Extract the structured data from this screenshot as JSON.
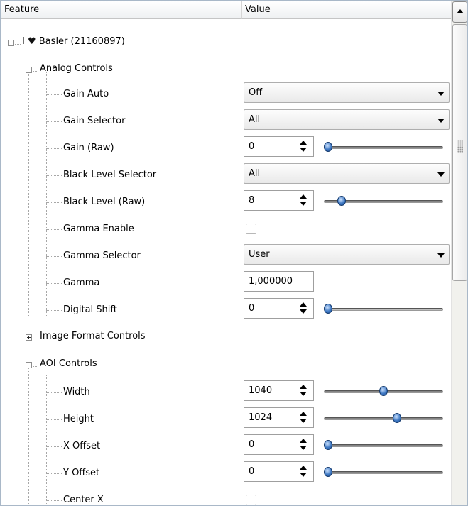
{
  "header": {
    "feature_label": "Feature",
    "value_label": "Value"
  },
  "root": {
    "prefix": "I",
    "heart": "♥",
    "name": "Basler (21160897)"
  },
  "groups": {
    "analog": "Analog Controls",
    "image_format": "Image Format Controls",
    "aoi": "AOI Controls"
  },
  "analog": {
    "gain_auto": {
      "label": "Gain Auto",
      "value": "Off"
    },
    "gain_selector": {
      "label": "Gain Selector",
      "value": "All"
    },
    "gain_raw": {
      "label": "Gain (Raw)",
      "value": "0",
      "level": 0.0
    },
    "black_level_selector": {
      "label": "Black Level Selector",
      "value": "All"
    },
    "black_level_raw": {
      "label": "Black Level (Raw)",
      "value": "8",
      "level": 0.12
    },
    "gamma_enable": {
      "label": "Gamma Enable",
      "checked": false
    },
    "gamma_selector": {
      "label": "Gamma Selector",
      "value": "User"
    },
    "gamma": {
      "label": "Gamma",
      "value": "1,000000"
    },
    "digital_shift": {
      "label": "Digital Shift",
      "value": "0",
      "level": 0.0
    }
  },
  "aoi": {
    "width": {
      "label": "Width",
      "value": "1040",
      "level": 0.5
    },
    "height": {
      "label": "Height",
      "value": "1024",
      "level": 0.62
    },
    "x_offset": {
      "label": "X Offset",
      "value": "0",
      "level": 0.0
    },
    "y_offset": {
      "label": "Y Offset",
      "value": "0",
      "level": 0.0
    },
    "center_x": {
      "label": "Center X",
      "checked": false
    }
  }
}
